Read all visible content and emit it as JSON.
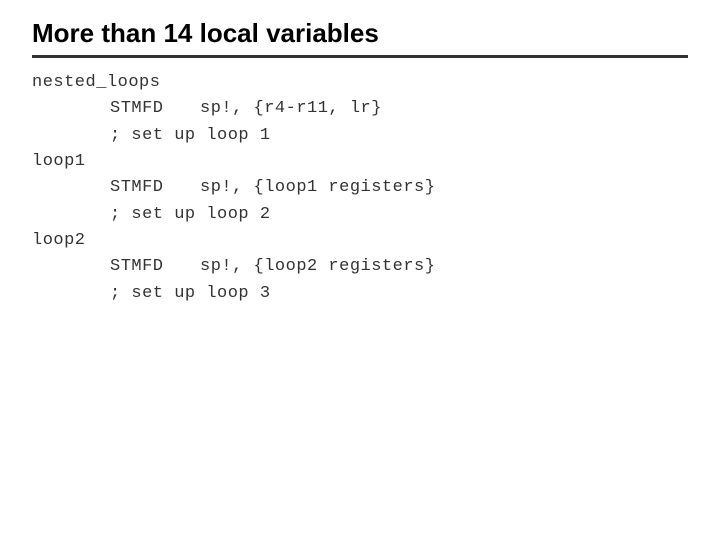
{
  "title": "More than 14 local variables",
  "code": {
    "lines": [
      {
        "label": "nested_loops",
        "op": "",
        "args": ""
      },
      {
        "label": "",
        "op": "STMFD",
        "args": "sp!, {r4-r11, lr}"
      },
      {
        "label": "",
        "op": "; set up loop 1",
        "args": ""
      },
      {
        "label": "loop1",
        "op": "",
        "args": ""
      },
      {
        "label": "",
        "op": "STMFD",
        "args": "sp!, {loop1 registers}"
      },
      {
        "label": "",
        "op": "; set up loop 2",
        "args": ""
      },
      {
        "label": "loop2",
        "op": "",
        "args": ""
      },
      {
        "label": "",
        "op": "STMFD",
        "args": "sp!, {loop2 registers}"
      },
      {
        "label": "",
        "op": "; set up loop 3",
        "args": ""
      }
    ]
  }
}
